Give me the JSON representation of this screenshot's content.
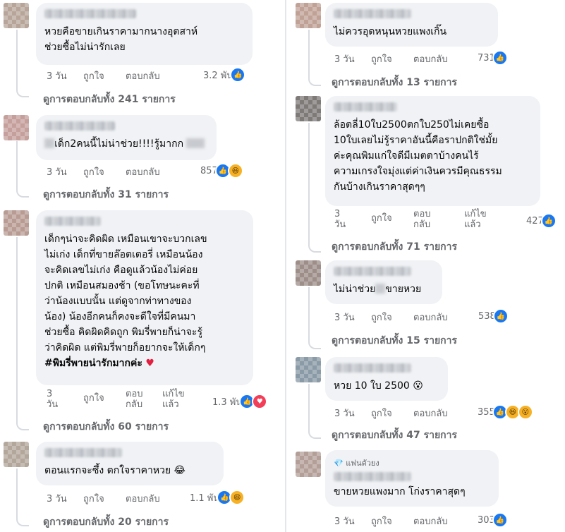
{
  "comments": [
    {
      "text": "หวยคือขายเกินราคามากนางอุตสาห์\nช่วยซื้อไม่น่ารักเลย",
      "time": "3 วัน",
      "like": "ถูกใจ",
      "reply": "ตอบกลับ",
      "count": "3.2 พัน",
      "replies": "ดูการตอบกลับทั้ง 241 รายการ",
      "avatar_color": "#b7a59a"
    },
    {
      "text_before": "",
      "text_after": "เด็ก2คนนี้ไม่น่าช่วย!!!!รู้มากก",
      "time": "3 วัน",
      "like": "ถูกใจ",
      "reply": "ตอบกลับ",
      "count": "857",
      "replies": "ดูการตอบกลับทั้ง 31 รายการ",
      "avatar_color": "#c59f9b"
    },
    {
      "text": "เด็กๆน่าจะคิดผิด เหมือนเขาจะบวกเลข\nไม่เก่ง เด็กที่ขายล๊อตเตอรี่ เหมือนน้อง\nจะคิดเลขไม่เก่ง คือดูแล้วน้องไม่ค่อย\nปกติ เหมือนสมองช้า (ขอโทษนะคะที่\nว่าน้องแบบนั้น แต่ดูจากท่าทางของ\nน้อง) น้องอีกคนก็คงจะดีใจที่มีคนมา\nช่วยซื้อ คิดผิดคิดถูก พิมรี่พายก็น่าจะรู้\nว่าคิดผิด แต่พิมรี่พายก็อยากจะให้เด็กๆ",
      "hashtag": "#พิมรี่พายน่ารักมากค่ะ",
      "heart": "♥",
      "time_num": "3",
      "time_unit": "วัน",
      "like": "ถูกใจ",
      "reply_a": "ตอบ",
      "reply_b": "กลับ",
      "edited_a": "แก้ไข",
      "edited_b": "แล้ว",
      "count": "1.3 พัน",
      "replies": "ดูการตอบกลับทั้ง 60 รายการ",
      "avatar_color": "#b89c94"
    },
    {
      "text": "ตอนแรกจะซึ้ง ตกใจราคาหวย 😂",
      "time": "3 วัน",
      "like": "ถูกใจ",
      "reply": "ตอบกลับ",
      "count": "1.1 พัน",
      "replies": "ดูการตอบกลับทั้ง 20 รายการ",
      "avatar_color": "#b3a69b"
    },
    {
      "text": "ไม่ควรอุดหนุนหวยแพงเกิ๊น",
      "time": "3 วัน",
      "like": "ถูกใจ",
      "reply": "ตอบกลับ",
      "count": "731",
      "replies": "ดูการตอบกลับทั้ง 13 รายการ",
      "avatar_color": "#c0a196"
    },
    {
      "text": "ล้อตลี่10ใบ2500ตกใบ250ไม่เคยซื้อ\n10ใบเลยไม่รู้ราคาอันนี้คือราปกติใช่มั้ย\nค่ะคุณพิมแก่ใจดีมีเมตตาบ้างคนไร้\nความเกรงใจมุ่งแต่ค่าเงินควรมีคุณธรรม\nกันบ้างเกินราคาสุดๆๆ",
      "time_num": "3",
      "time_unit": "วัน",
      "like": "ถูกใจ",
      "reply_a": "ตอบ",
      "reply_b": "กลับ",
      "edited_a": "แก้ไข",
      "edited_b": "แล้ว",
      "count": "427",
      "replies": "ดูการตอบกลับทั้ง 71 รายการ",
      "avatar_color": "#7d7a78"
    },
    {
      "text_before": "ไม่น่าช่วย",
      "text_after": "ขายหวย",
      "time": "3 วัน",
      "like": "ถูกใจ",
      "reply": "ตอบกลับ",
      "count": "538",
      "replies": "ดูการตอบกลับทั้ง 15 รายการ",
      "avatar_color": "#9d8e89"
    },
    {
      "text": "หวย 10 ใบ 2500 😮",
      "time": "3 วัน",
      "like": "ถูกใจ",
      "reply": "ตอบกลับ",
      "count": "355",
      "replies": "ดูการตอบกลับทั้ง 47 รายการ",
      "avatar_color": "#8a9aa6"
    },
    {
      "badge": "แฟนตัวยง",
      "text": "ขายหวยแพงมาก โก่งราคาสุดๆ",
      "time": "3 วัน",
      "like": "ถูกใจ",
      "reply": "ตอบกลับ",
      "count": "303",
      "avatar_color": "#b49f98"
    }
  ],
  "icons": {
    "like": "👍",
    "love": "♥",
    "haha": "😆",
    "wow": "😮",
    "diamond": "💎"
  }
}
